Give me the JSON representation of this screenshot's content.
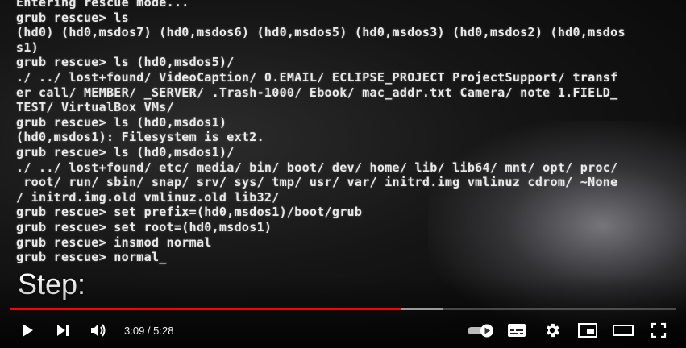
{
  "terminal": {
    "lines": [
      "Entering rescue mode...",
      "grub rescue> ls",
      "(hd0) (hd0,msdos7) (hd0,msdos6) (hd0,msdos5) (hd0,msdos3) (hd0,msdos2) (hd0,msdos",
      "s1)",
      "grub rescue> ls (hd0,msdos5)/",
      "./ ../ lost+found/ VideoCaption/ 0.EMAIL/ ECLIPSE_PROJECT ProjectSupport/ transf",
      "er call/ MEMBER/ _SERVER/ .Trash-1000/ Ebook/ mac_addr.txt Camera/ note 1.FIELD_",
      "TEST/ VirtualBox VMs/",
      "grub rescue> ls (hd0,msdos1)",
      "(hd0,msdos1): Filesystem is ext2.",
      "grub rescue> ls (hd0,msdos1)/",
      "./ ../ lost+found/ etc/ media/ bin/ boot/ dev/ home/ lib/ lib64/ mnt/ opt/ proc/",
      " root/ run/ sbin/ snap/ srv/ sys/ tmp/ usr/ var/ initrd.img vmlinuz cdrom/ ~None",
      "/ initrd.img.old vmlinuz.old lib32/",
      "grub rescue> set prefix=(hd0,msdos1)/boot/grub",
      "grub rescue> set root=(hd0,msdos1)",
      "grub rescue> insmod normal",
      "grub rescue> normal"
    ],
    "cursor": "_"
  },
  "caption": "Step:",
  "player": {
    "progress_fraction": 0.5868,
    "buffered_fraction": 0.65,
    "time_display": "3:09 / 5:28",
    "colors": {
      "played": "#ff0000",
      "controls": "#ffffff"
    }
  },
  "icons": {
    "play": "play-icon",
    "next": "next-icon",
    "volume": "volume-icon",
    "autoplay": "autoplay-toggle-icon",
    "subtitles": "subtitles-icon",
    "settings": "gear-icon",
    "miniplayer": "miniplayer-icon",
    "theater": "theater-mode-icon",
    "fullscreen": "fullscreen-icon"
  }
}
